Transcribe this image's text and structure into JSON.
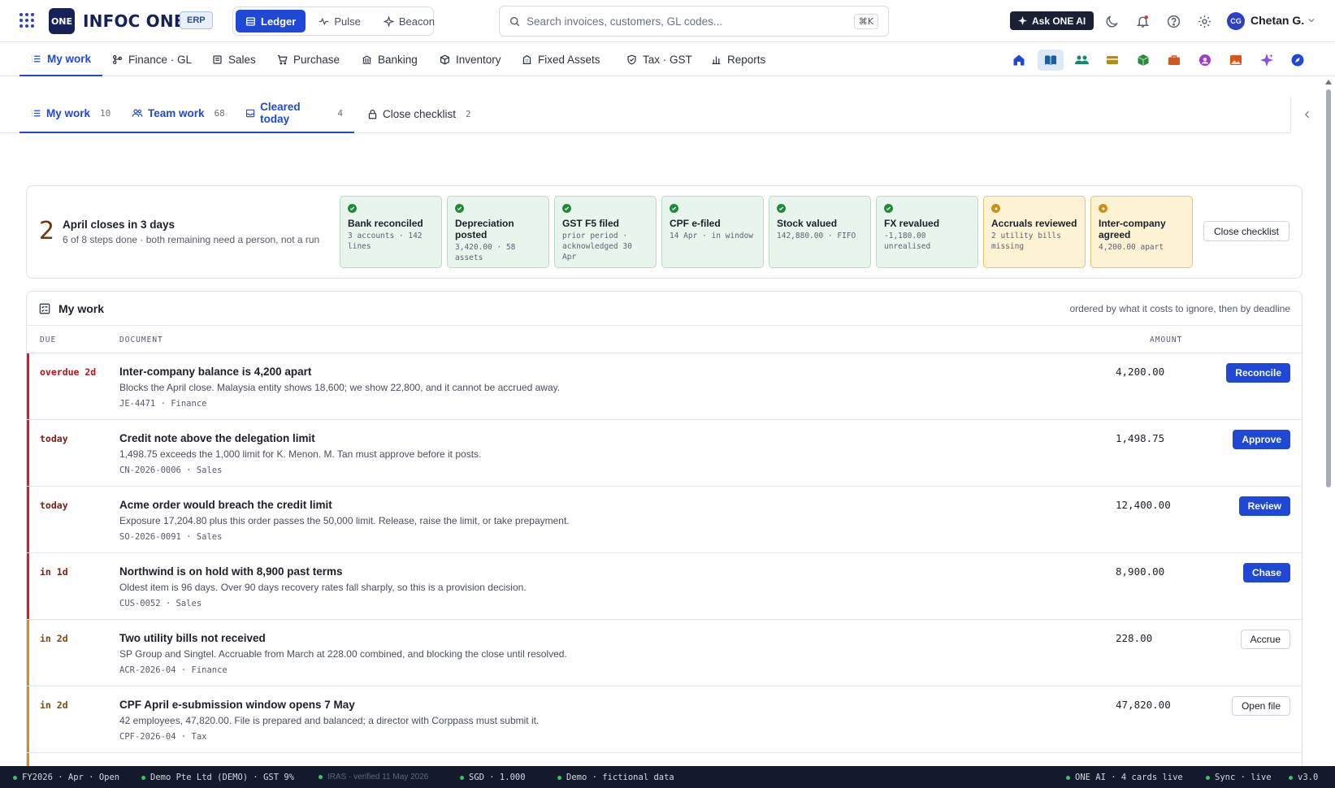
{
  "topbar": {
    "logo_badge": "ONE",
    "app_name": "INFOC ONE",
    "erp_badge": "ERP",
    "modes": [
      {
        "label": "Ledger",
        "active": true
      },
      {
        "label": "Pulse",
        "active": false
      },
      {
        "label": "Beacon",
        "active": false
      }
    ],
    "search_placeholder": "Search invoices, customers, GL codes...",
    "search_shortcut": "⌘K",
    "ask_label": "Ask ONE AI",
    "user_initials": "CG",
    "user_name": "Chetan G."
  },
  "modules": [
    {
      "label": "My work",
      "icon": "list-icon",
      "active": true
    },
    {
      "label": "Finance · GL",
      "icon": "branch-icon"
    },
    {
      "label": "Sales",
      "icon": "receipt-icon"
    },
    {
      "label": "Purchase",
      "icon": "cart-icon"
    },
    {
      "label": "Banking",
      "icon": "bank-icon"
    },
    {
      "label": "Inventory",
      "icon": "box-icon"
    },
    {
      "label": "Fixed Assets",
      "icon": "building-icon"
    },
    {
      "label": "Tax · GST",
      "icon": "shield-icon"
    },
    {
      "label": "Reports",
      "icon": "bar-chart-icon"
    }
  ],
  "app_shortcuts": [
    {
      "name": "home-app-icon",
      "color": "#1f48d6"
    },
    {
      "name": "book-app-icon",
      "color": "#1a5fa0"
    },
    {
      "name": "people-app-icon",
      "color": "#15876f"
    },
    {
      "name": "card-app-icon",
      "color": "#b48a1a"
    },
    {
      "name": "cube-app-icon",
      "color": "#2b8a3e"
    },
    {
      "name": "briefcase-app-icon",
      "color": "#d1561f"
    },
    {
      "name": "circle-app-icon",
      "color": "#9b3fc0"
    },
    {
      "name": "image-app-icon",
      "color": "#d8561a"
    },
    {
      "name": "sparkle-app-icon",
      "color": "#8a4fe0"
    },
    {
      "name": "compass-app-icon",
      "color": "#1f48d6"
    }
  ],
  "subtabs": [
    {
      "label": "My work",
      "count": "10"
    },
    {
      "label": "Team work",
      "count": "68"
    },
    {
      "label": "Cleared today",
      "count": "4"
    },
    {
      "label": "Close checklist",
      "count": "2"
    }
  ],
  "close": {
    "days": "2",
    "title": "April closes in 3 days",
    "subtitle": "6 of 8 steps done · both remaining need a person, not a run",
    "button": "Close checklist",
    "steps": [
      {
        "title": "Bank reconciled",
        "detail": "3 accounts · 142 lines",
        "status": "done"
      },
      {
        "title": "Depreciation posted",
        "detail": "3,420.00 · 58 assets",
        "status": "done"
      },
      {
        "title": "GST F5 filed",
        "detail": "prior period · acknowledged 30 Apr",
        "status": "done"
      },
      {
        "title": "CPF e-filed",
        "detail": "14 Apr · in window",
        "status": "done"
      },
      {
        "title": "Stock valued",
        "detail": "142,880.00 · FIFO",
        "status": "done"
      },
      {
        "title": "FX revalued",
        "detail": "-1,180.00 unrealised",
        "status": "done"
      },
      {
        "title": "Accruals reviewed",
        "detail": "2 utility bills missing",
        "status": "wait"
      },
      {
        "title": "Inter-company agreed",
        "detail": "4,200.00 apart",
        "status": "wait"
      }
    ]
  },
  "work": {
    "title": "My work",
    "note": "ordered by what it costs to ignore, then by deadline",
    "columns": {
      "due": "DUE",
      "document": "DOCUMENT",
      "amount": "AMOUNT"
    },
    "rows": [
      {
        "due": "overdue 2d",
        "title": "Inter-company balance is 4,200 apart",
        "desc": "Blocks the April close. Malaysia entity shows 18,600; we show 22,800, and it cannot be accrued away.",
        "ref": "JE-4471 · Finance",
        "amount": "4,200.00",
        "action": "Reconcile",
        "primary": true,
        "bar": "#d0202a",
        "due_color": "#b3151f"
      },
      {
        "due": "today",
        "title": "Credit note above the delegation limit",
        "desc": "1,498.75 exceeds the 1,000 limit for K. Menon. M. Tan must approve before it posts.",
        "ref": "CN-2026-0006 · Sales",
        "amount": "1,498.75",
        "action": "Approve",
        "primary": true,
        "bar": "#d0202a",
        "due_color": "#7a1f16"
      },
      {
        "due": "today",
        "title": "Acme order would breach the credit limit",
        "desc": "Exposure 17,204.80 plus this order passes the 50,000 limit. Release, raise the limit, or take prepayment.",
        "ref": "SO-2026-0091 · Sales",
        "amount": "12,400.00",
        "action": "Review",
        "primary": true,
        "bar": "#d0202a",
        "due_color": "#7a1f16"
      },
      {
        "due": "in 1d",
        "title": "Northwind is on hold with 8,900 past terms",
        "desc": "Oldest item is 96 days. Over 90 days recovery rates fall sharply, so this is a provision decision.",
        "ref": "CUS-0052 · Sales",
        "amount": "8,900.00",
        "action": "Chase",
        "primary": true,
        "bar": "#d0202a",
        "due_color": "#7a1f16"
      },
      {
        "due": "in 2d",
        "title": "Two utility bills not received",
        "desc": "SP Group and Singtel. Accruable from March at 228.00 combined, and blocking the close until resolved.",
        "ref": "ACR-2026-04 · Finance",
        "amount": "228.00",
        "action": "Accrue",
        "primary": false,
        "bar": "#c99218",
        "due_color": "#7a4a12"
      },
      {
        "due": "in 2d",
        "title": "CPF April e-submission window opens 7 May",
        "desc": "42 employees, 47,820.00. File is prepared and balanced; a director with Corppass must submit it.",
        "ref": "CPF-2026-04 · Tax",
        "amount": "47,820.00",
        "action": "Open file",
        "primary": false,
        "bar": "#c99218",
        "due_color": "#7a4a12"
      }
    ]
  },
  "statusbar": {
    "left": [
      "FY2026 · Apr · Open",
      "Demo Pte Ltd (DEMO) · GST 9%"
    ],
    "verified": "IRAS · verified 11 May 2026",
    "middle": [
      "SGD · 1.000",
      "Demo · fictional data"
    ],
    "right": [
      "ONE AI · 4 cards live",
      "Sync · live",
      "v3.0"
    ]
  }
}
